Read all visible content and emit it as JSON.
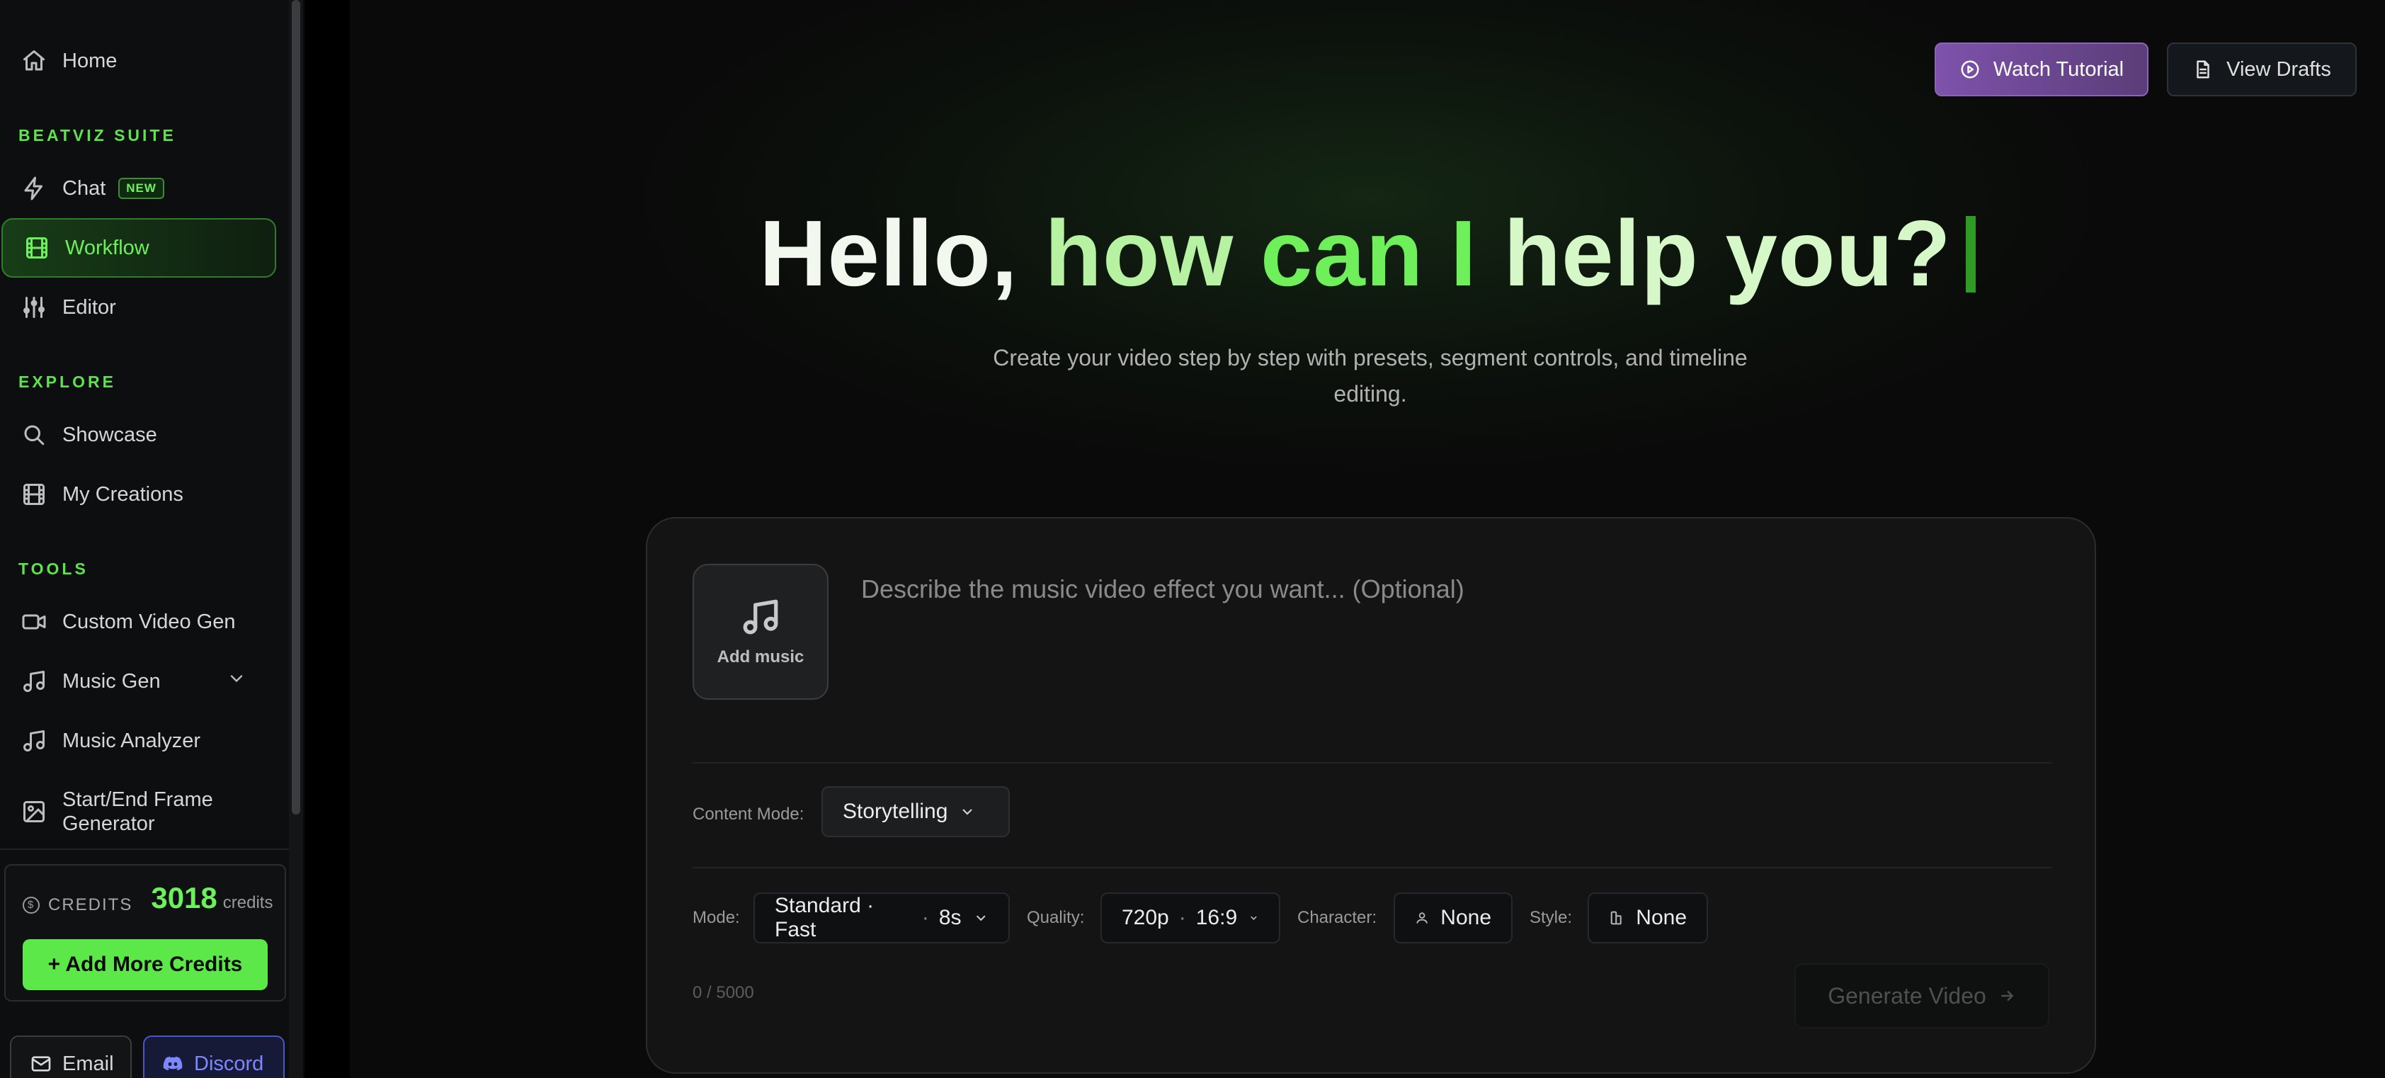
{
  "sidebar": {
    "home": {
      "label": "Home",
      "icon": "home-icon"
    },
    "sections": {
      "suite": "BEATVIZ SUITE",
      "explore": "EXPLORE",
      "tools": "TOOLS"
    },
    "suite_items": [
      {
        "label": "Chat",
        "icon": "zap-icon",
        "badge": "NEW"
      },
      {
        "label": "Workflow",
        "icon": "film-icon",
        "active": true
      },
      {
        "label": "Editor",
        "icon": "sliders-icon"
      }
    ],
    "explore_items": [
      {
        "label": "Showcase",
        "icon": "search-icon"
      },
      {
        "label": "My Creations",
        "icon": "film-icon"
      }
    ],
    "tools_items": [
      {
        "label": "Custom Video Gen",
        "icon": "video-icon"
      },
      {
        "label": "Music Gen",
        "icon": "music-icon",
        "expandable": true
      },
      {
        "label": "Music Analyzer",
        "icon": "music-icon"
      },
      {
        "label": "Start/End Frame Generator",
        "icon": "image-icon"
      }
    ],
    "credits": {
      "label": "CREDITS",
      "amount": "3018",
      "unit": "credits",
      "add_button": "+ Add More Credits"
    },
    "footer": {
      "email": "Email",
      "discord": "Discord"
    }
  },
  "header": {
    "watch_tutorial": "Watch Tutorial",
    "view_drafts": "View Drafts"
  },
  "hero": {
    "word1": "Hello,",
    "word2": "how",
    "word3": "can I",
    "word4": "help you?",
    "subtitle": "Create your video step by step with presets, segment controls, and timeline editing."
  },
  "composer": {
    "add_music": "Add music",
    "prompt_placeholder": "Describe the music video effect you want... (Optional)",
    "content_mode": {
      "label": "Content Mode:",
      "value": "Storytelling"
    },
    "mode": {
      "label": "Mode:",
      "value": "Standard · Fast",
      "duration": "8s"
    },
    "quality": {
      "label": "Quality:",
      "resolution": "720p",
      "ratio": "16:9"
    },
    "character": {
      "label": "Character:",
      "value": "None"
    },
    "style": {
      "label": "Style:",
      "value": "None"
    },
    "counter": "0 / 5000",
    "generate": "Generate Video"
  },
  "colors": {
    "accent_green": "#6cf05c",
    "tutorial_purple": "#7e52ac",
    "discord_blue": "#7d87ff",
    "background": "#0a0a0a"
  }
}
